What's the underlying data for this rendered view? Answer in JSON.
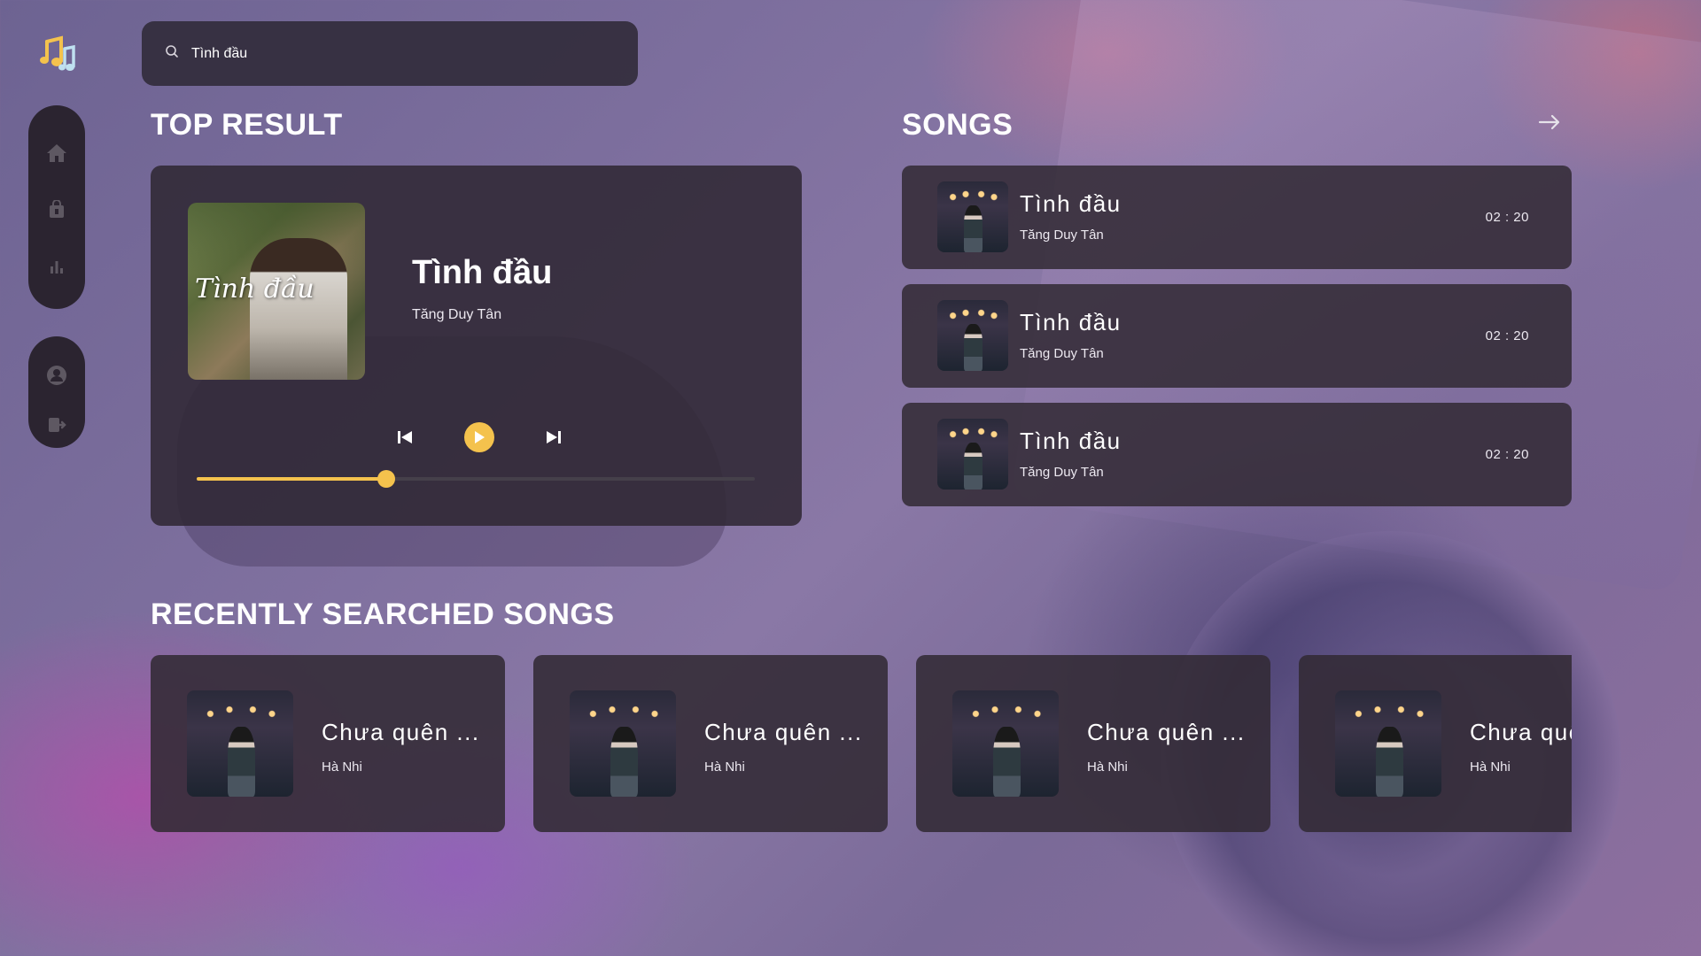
{
  "app": {
    "logo_icon": "music-notes-icon",
    "accent_color": "#f4c24d"
  },
  "nav": {
    "main_items": [
      {
        "icon": "home-icon"
      },
      {
        "icon": "library-icon"
      },
      {
        "icon": "chart-icon"
      }
    ],
    "user_items": [
      {
        "icon": "user-icon"
      },
      {
        "icon": "logout-icon"
      }
    ]
  },
  "search": {
    "value": "Tình đầu"
  },
  "top_result": {
    "heading": "TOP RESULT",
    "cover_text": "Tình đầu",
    "title": "Tình đầu",
    "artist": "Tăng Duy Tân",
    "progress": 0.34
  },
  "songs": {
    "heading": "SONGS",
    "items": [
      {
        "title": "Tình đầu",
        "artist": "Tăng Duy Tân",
        "duration": "02 : 20"
      },
      {
        "title": "Tình đầu",
        "artist": "Tăng Duy Tân",
        "duration": "02 : 20"
      },
      {
        "title": "Tình đầu",
        "artist": "Tăng Duy Tân",
        "duration": "02 : 20"
      }
    ]
  },
  "recent": {
    "heading": "RECENTLY SEARCHED SONGS",
    "items": [
      {
        "title": "Chưa quên ...",
        "artist": "Hà Nhi"
      },
      {
        "title": "Chưa quên ...",
        "artist": "Hà Nhi"
      },
      {
        "title": "Chưa quên ...",
        "artist": "Hà Nhi"
      },
      {
        "title": "Chưa quên ...",
        "artist": "Hà Nhi"
      }
    ]
  }
}
